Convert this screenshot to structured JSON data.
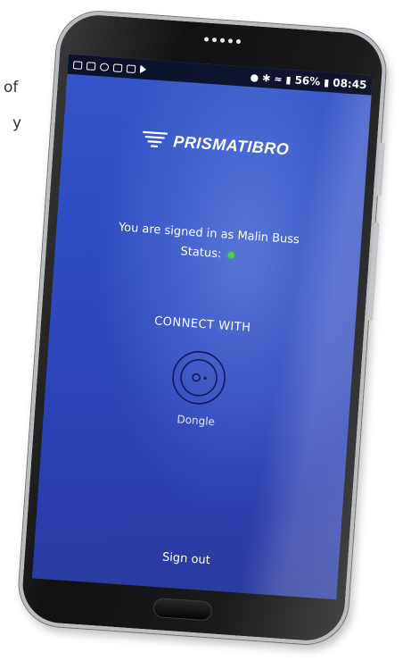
{
  "background_text": {
    "line1": "of",
    "line2": "y"
  },
  "status_bar": {
    "notification_icons": [
      "mail-icon",
      "cast-icon",
      "circle-icon",
      "gallery-icon",
      "image-icon",
      "play-icon"
    ],
    "battery_percent": "56%",
    "time": "08:45"
  },
  "app": {
    "logo_text": "PRISMATIBRO",
    "signed_in_text": "You are signed in as Malin Buss",
    "status_label": "Status:",
    "status_color": "#4cd24a",
    "connect_heading": "CONNECT WITH",
    "dongle_label": "Dongle",
    "sign_out_label": "Sign out"
  },
  "colors": {
    "screen_blue": "#2d49bd",
    "status_bar": "#000000"
  }
}
